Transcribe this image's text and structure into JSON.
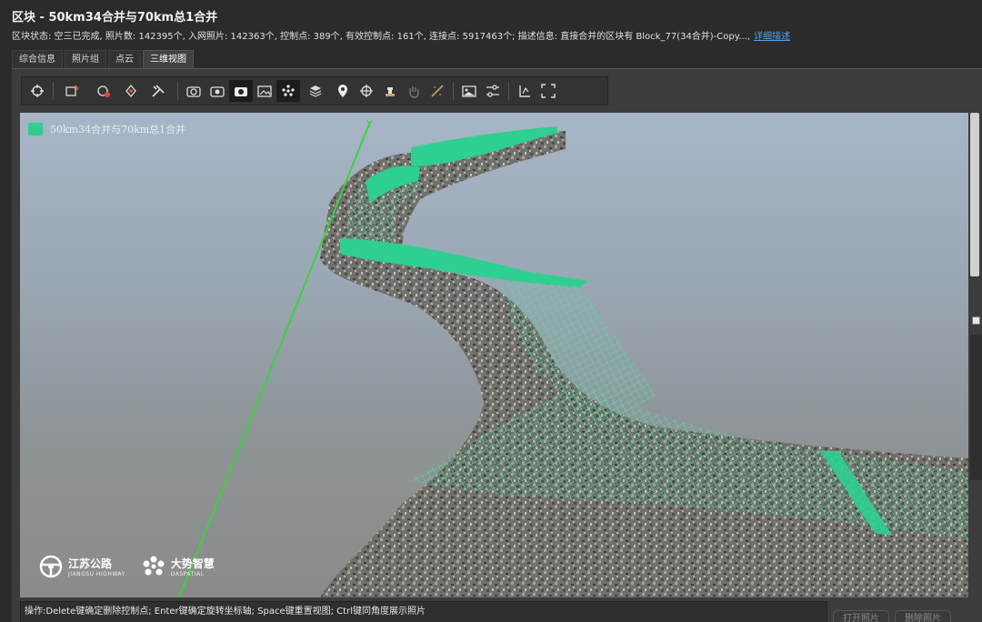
{
  "window": {
    "title": "区块 - 50km34合并与70km总1合并"
  },
  "status": {
    "text": "区块状态: 空三已完成, 照片数: 142395个, 入网照片: 142363个, 控制点: 389个, 有效控制点: 161个, 连接点: 5917463个; 描述信息: 直接合并的区块有 Block_77(34合并)-Copy...,",
    "link_label": "详细描述"
  },
  "tabs": [
    "综合信息",
    "照片组",
    "点云",
    "三维视图"
  ],
  "active_tab": "三维视图",
  "toolbar": {
    "icons": [
      "navigate-icon",
      "import-photo-icon",
      "camera-filter-icon",
      "control-point-icon",
      "tools-icon",
      "camera-rotate-icon",
      "camera-refresh-icon",
      "camera-icon",
      "photo-view-icon",
      "point-cloud-icon",
      "layers-icon",
      "location-pin-icon",
      "crosshair-icon",
      "stamp-icon",
      "hand-icon",
      "texture-icon",
      "image-icon",
      "sliders-icon",
      "measure-icon",
      "fit-view-icon"
    ]
  },
  "viewport": {
    "legend_label": "50km34合并与70km总1合并",
    "legend_color": "#2ecf91",
    "axis_label": "Y",
    "axis_color": "#3bd23b"
  },
  "logos": {
    "jiangsu_main": "江苏公路",
    "jiangsu_sub": "JIANGSU HIGHWAY",
    "daspatial_main": "大势智慧",
    "daspatial_sub": "DASPATIAL"
  },
  "hint": {
    "text": "操作:Delete键确定删除控制点; Enter键确定旋转坐标轴; Space键重置视图; Ctrl键同角度展示照片"
  },
  "bottom_buttons": {
    "open_photo": "打开照片",
    "delete_photo": "删除照片"
  }
}
